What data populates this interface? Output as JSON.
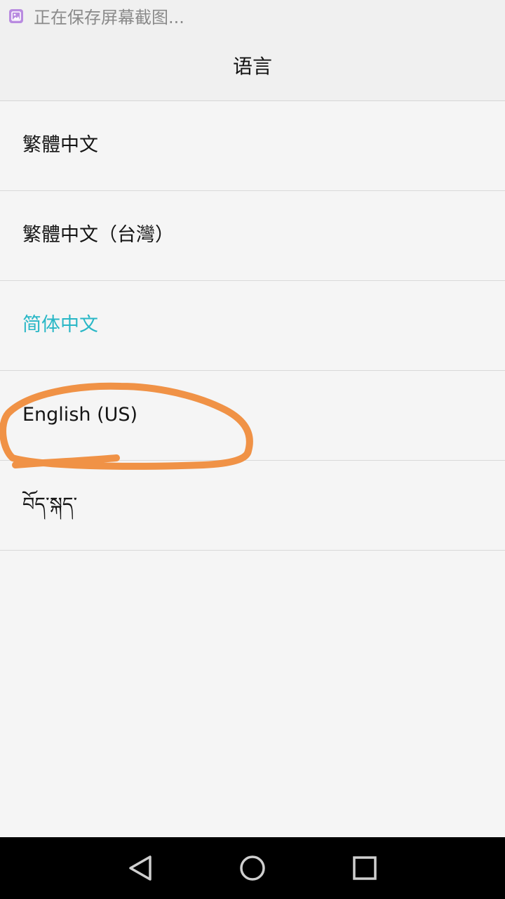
{
  "status_bar": {
    "notification_icon": "screenshot-image-icon",
    "text": "正在保存屏幕截图..."
  },
  "header": {
    "title": "语言"
  },
  "languages": [
    {
      "label": "繁體中文",
      "selected": false
    },
    {
      "label": "繁體中文（台灣）",
      "selected": false
    },
    {
      "label": "简体中文",
      "selected": true
    },
    {
      "label": "English (US)",
      "selected": false
    },
    {
      "label": "བོད་སྐད་",
      "selected": false
    }
  ],
  "colors": {
    "selected_text": "#29b7c6",
    "annotation": "#f09246",
    "background": "#f5f5f5"
  },
  "nav_bar": {
    "icons": [
      "back-triangle-icon",
      "home-circle-icon",
      "recents-square-icon"
    ]
  }
}
